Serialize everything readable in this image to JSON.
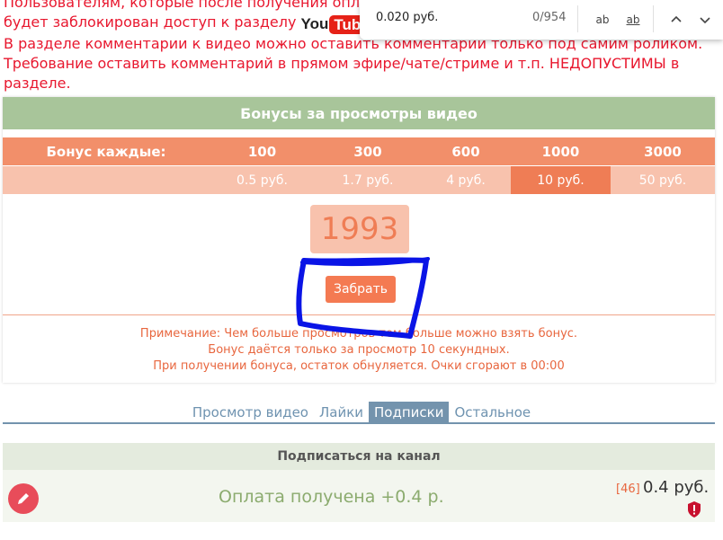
{
  "notice": {
    "line1": "Пользователям, которые после получения оплат",
    "line2_prefix": "будет заблокирован доступ к разделу",
    "youtube_you": "You",
    "youtube_tube": "Tube",
    "line2_suffix": "!",
    "line3": "В разделе комментарии к видео можно оставить комментарии только под самим роликом.",
    "line4": "Требование оставить комментарий в прямом эфире/чате/стриме и т.п. НЕДОПУСТИМЫ в",
    "line5": "разделе."
  },
  "findbar": {
    "query": "0.020 руб.",
    "count": "0/954",
    "match_case_label": "ab",
    "whole_word_label": "ab"
  },
  "bonus": {
    "title": "Бонусы за просмотры видео",
    "row_label": "Бонус каждые:",
    "thresholds": [
      "100",
      "300",
      "600",
      "1000",
      "3000"
    ],
    "rewards": [
      "0.5 руб.",
      "1.7 руб.",
      "4 руб.",
      "10 руб.",
      "50 руб."
    ],
    "counter": "1993",
    "claim_label": "Забрать",
    "note1": "Примечание: Чем больше просмотров тем больше можно взять бонус.",
    "note2": "Бонус даётся только за просмотр 10 секундных.",
    "note3": "При получении бонуса, остаток обнуляется. Очки сгорают в 00:00"
  },
  "tabs": [
    "Просмотр видео",
    "Лайки",
    "Подписки",
    "Остальное"
  ],
  "subscribe": {
    "title": "Подписаться на канал",
    "status": "Оплата получена +0.4 р.",
    "count": "[46]",
    "price": "0.4 руб."
  },
  "colors": {
    "notice_red": "#e8172e",
    "bonus_header_green": "#a8c59a",
    "orange": "#f28f6a",
    "scribble_blue": "#0a14e6"
  }
}
